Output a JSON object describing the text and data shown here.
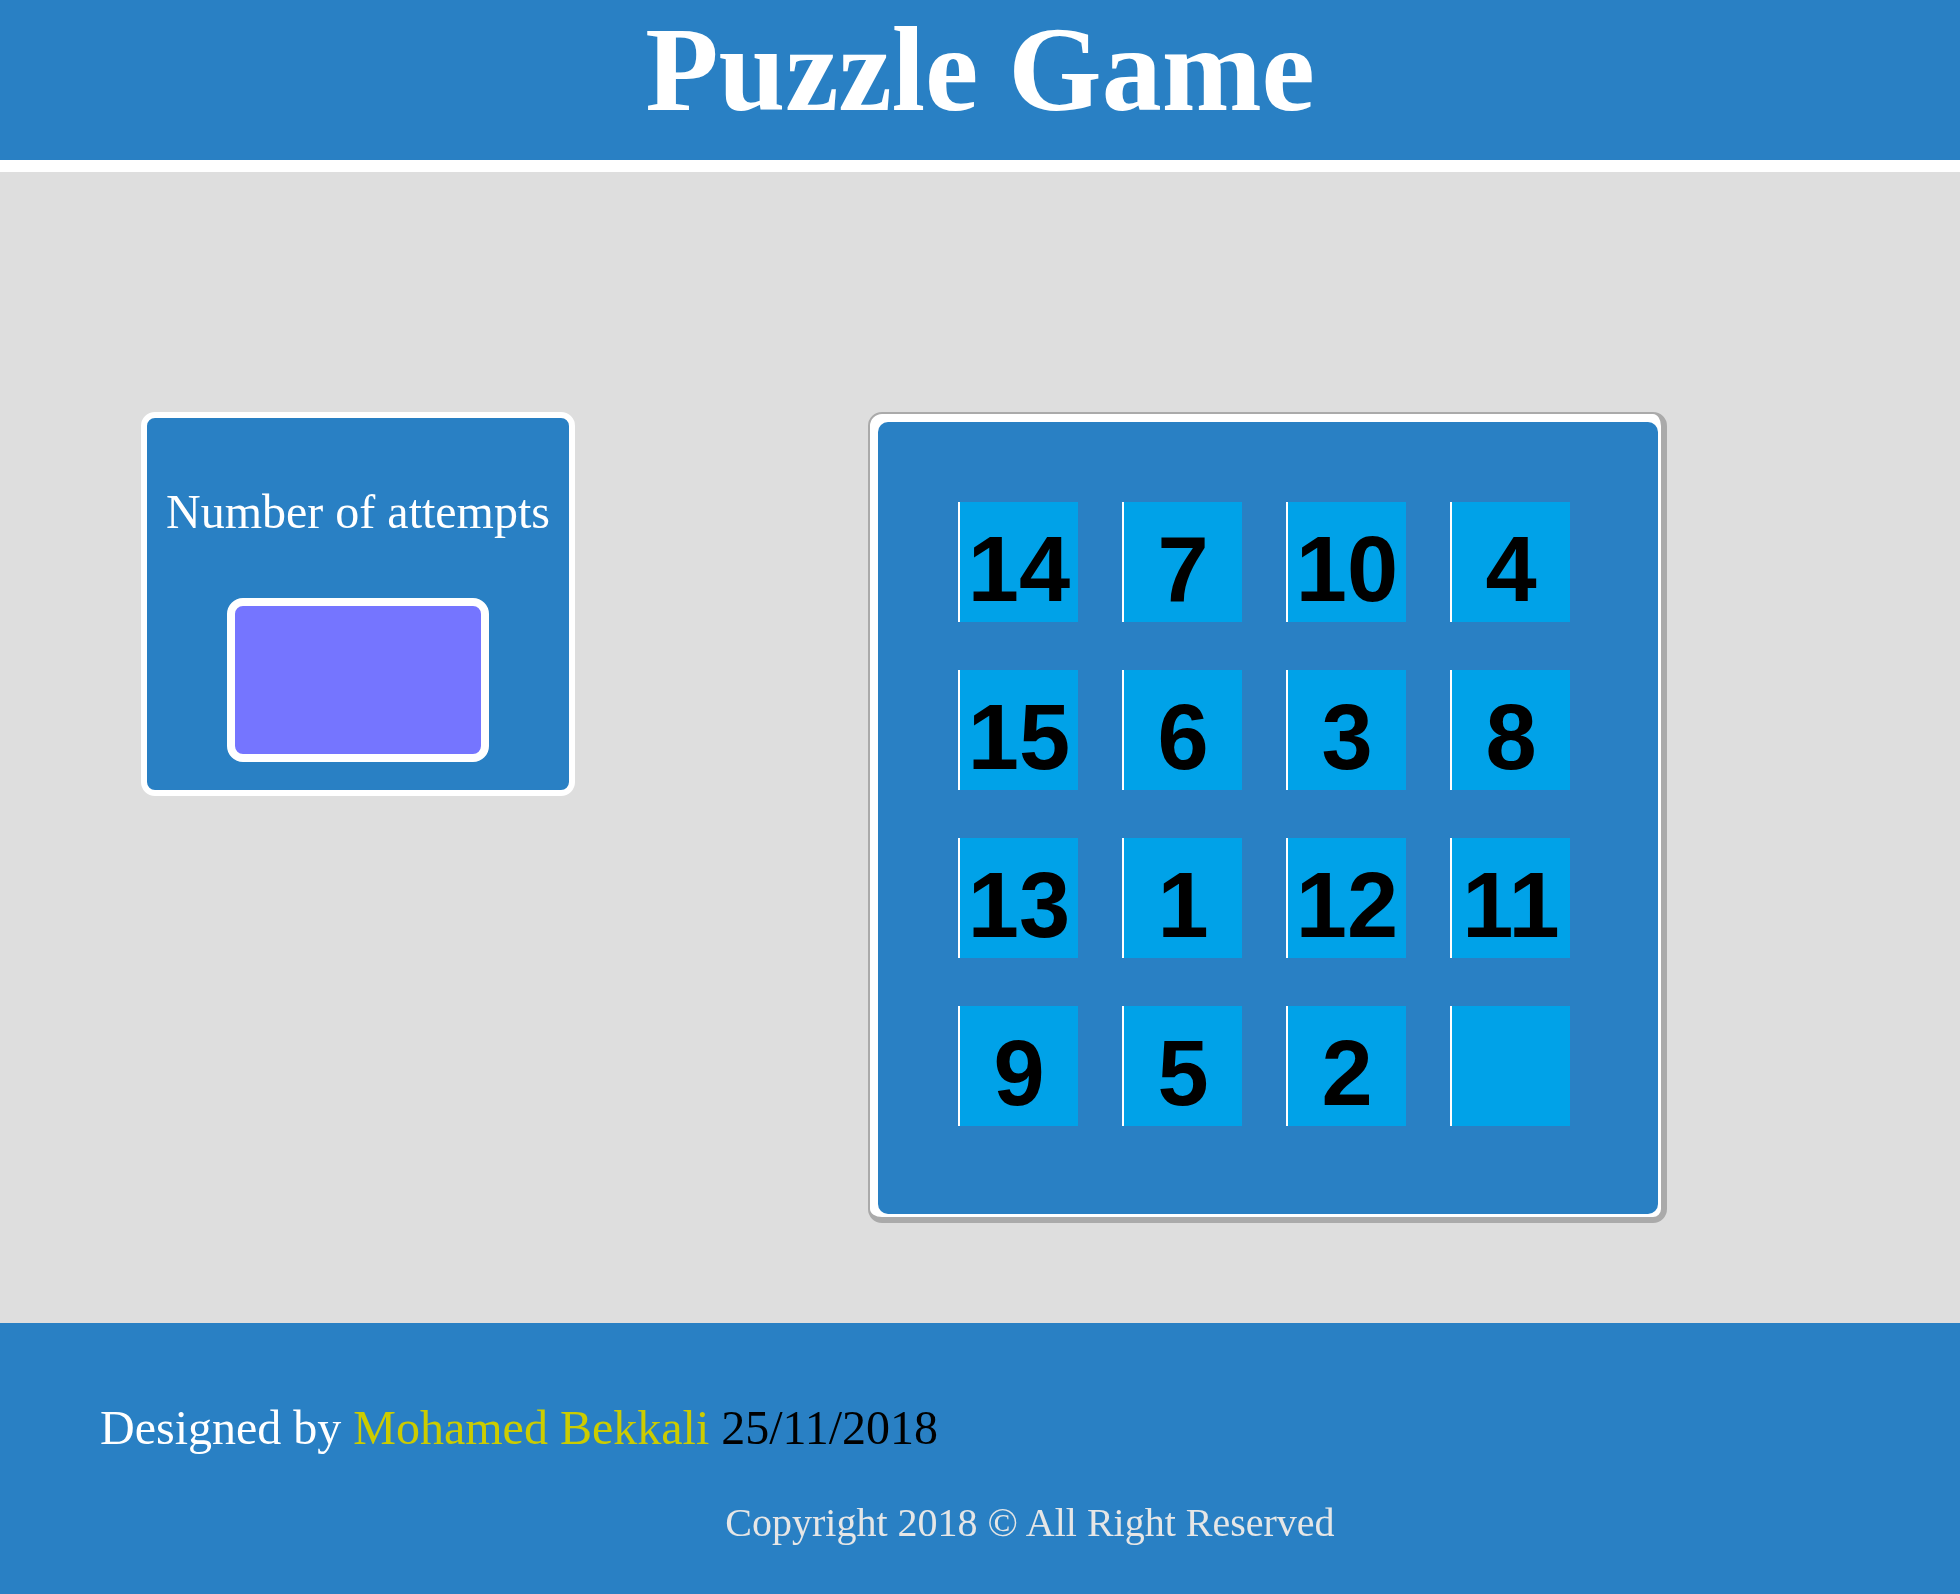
{
  "header": {
    "title": "Puzzle Game"
  },
  "attempts": {
    "label": "Number of attempts"
  },
  "board": {
    "tiles": [
      {
        "kind": "number",
        "label": "14"
      },
      {
        "kind": "number",
        "label": "7"
      },
      {
        "kind": "number",
        "label": "10"
      },
      {
        "kind": "number",
        "label": "4"
      },
      {
        "kind": "number",
        "label": "15"
      },
      {
        "kind": "number",
        "label": "6"
      },
      {
        "kind": "number",
        "label": "3"
      },
      {
        "kind": "number",
        "label": "8"
      },
      {
        "kind": "number",
        "label": "13"
      },
      {
        "kind": "number",
        "label": "1"
      },
      {
        "kind": "number",
        "label": "12"
      },
      {
        "kind": "number",
        "label": "11"
      },
      {
        "kind": "number",
        "label": "9"
      },
      {
        "kind": "number",
        "label": "5"
      },
      {
        "kind": "number",
        "label": "2"
      },
      {
        "kind": "blank"
      }
    ]
  },
  "footer": {
    "credit": {
      "lead": "Designed by",
      "author": "Mohamed Bekkali",
      "date": "25/11/2018"
    },
    "copyright": "Copyright 2018 © All Right Reserved"
  }
}
